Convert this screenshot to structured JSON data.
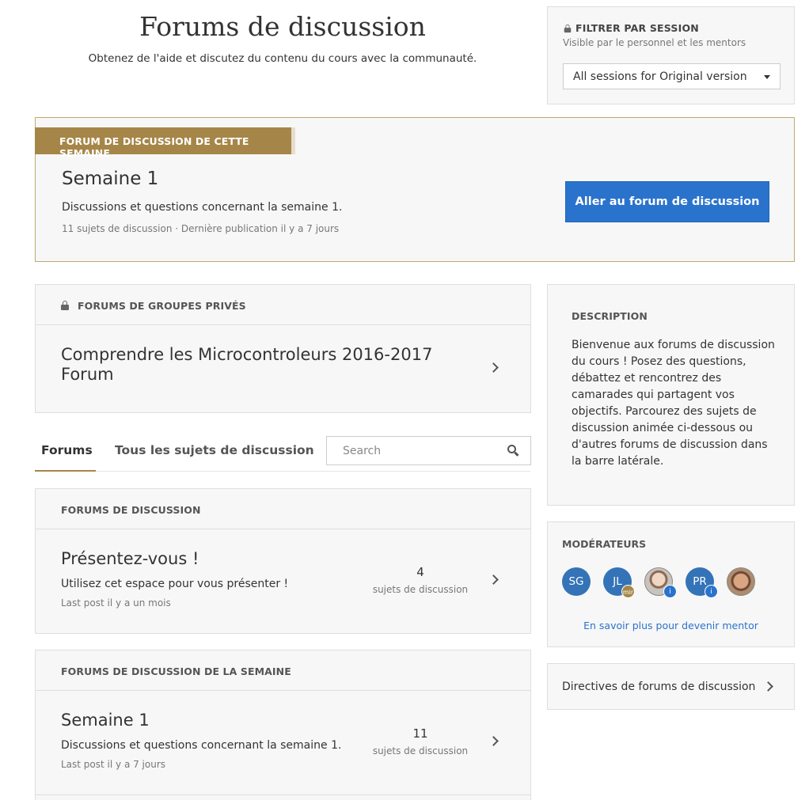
{
  "header": {
    "title": "Forums de discussion",
    "subtitle": "Obtenez de l'aide et discutez du contenu du cours avec la communauté."
  },
  "session_filter": {
    "title": "FILTRER PAR SESSION",
    "subtitle": "Visible par le personnel et les mentors",
    "selected": "All sessions for Original version"
  },
  "weekly_forum": {
    "badge": "FORUM DE DISCUSSION DE CETTE SEMAINE",
    "title": "Semaine 1",
    "description": "Discussions et questions concernant la semaine 1.",
    "meta": "11 sujets de discussion · Dernière publication il y a 7 jours",
    "button_label": "Aller au forum de discussion"
  },
  "private_groups": {
    "header": "FORUMS DE GROUPES PRIVÉS",
    "items": [
      {
        "title": "Comprendre les Microcontroleurs 2016-2017 Forum"
      }
    ]
  },
  "tabs": {
    "items": [
      {
        "label": "Forums",
        "active": true
      },
      {
        "label": "Tous les sujets de discussion",
        "active": false
      }
    ],
    "search_placeholder": "Search"
  },
  "discussion_forums": {
    "header": "FORUMS DE DISCUSSION",
    "items": [
      {
        "title": "Présentez-vous !",
        "description": "Utilisez cet espace pour vous présenter !",
        "meta": "Last post il y a un mois",
        "count": "4",
        "count_label": "sujets de discussion"
      }
    ]
  },
  "weekly_forums": {
    "header": "FORUMS DE DISCUSSION DE LA SEMAINE",
    "items": [
      {
        "title": "Semaine 1",
        "description": "Discussions et questions concernant la semaine 1.",
        "meta": "Last post il y a 7 jours",
        "count": "11",
        "count_label": "sujets de discussion"
      }
    ]
  },
  "description": {
    "title": "DESCRIPTION",
    "body": "Bienvenue aux forums de discussion du cours ! Posez des questions, débattez et rencontrez des camarades qui partagent vos objectifs. Parcourez des sujets de discussion animée ci-dessous ou d'autres forums de discussion dans la barre latérale."
  },
  "moderators": {
    "title": "MODÉRATEURS",
    "avatars": [
      {
        "initials": "SG",
        "badge": ""
      },
      {
        "initials": "JL",
        "badge": "mir"
      },
      {
        "initials": "",
        "badge": "i"
      },
      {
        "initials": "PR",
        "badge": "i"
      },
      {
        "initials": "",
        "badge": ""
      }
    ],
    "link": "En savoir plus pour devenir mentor"
  },
  "guidelines": {
    "label": "Directives de forums de discussion"
  },
  "colors": {
    "accent_gold": "#a68648",
    "primary_blue": "#2a73cc",
    "card_bg": "#f7f7f7"
  }
}
